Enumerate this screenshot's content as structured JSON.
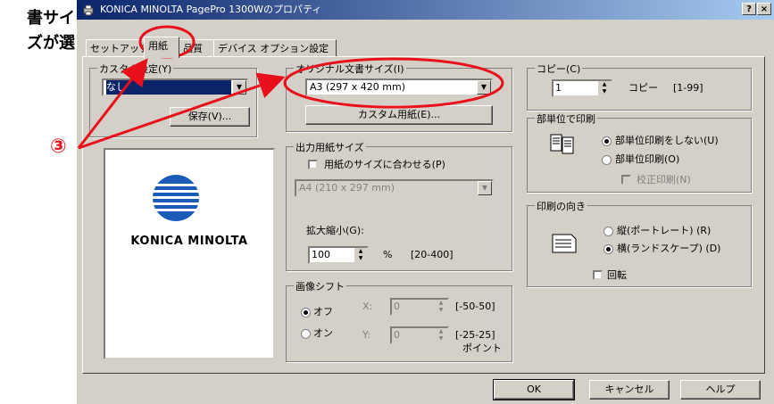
{
  "doc": {
    "line1": "書サイ",
    "line2": "ズが選"
  },
  "window": {
    "title": "KONICA MINOLTA PagePro 1300Wのプロパティ",
    "help_btn": "?",
    "close_btn": "×"
  },
  "tabs": [
    {
      "label": "セットアップ"
    },
    {
      "label": "用紙"
    },
    {
      "label": "品質"
    },
    {
      "label": "デバイス オプション設定"
    }
  ],
  "custom": {
    "label": "カスタム設定(Y)",
    "value": "なし",
    "save": "保存(V)..."
  },
  "logo": {
    "text": "KONICA MINOLTA"
  },
  "paper": {
    "label": "オリジナル文書サイズ(I)",
    "value": "A3 (297 x 420 mm)",
    "custom_button": "カスタム用紙(E)..."
  },
  "output": {
    "label": "出力用紙サイズ",
    "fit": "用紙のサイズに合わせる(P)",
    "size": "A4 (210 x 297 mm)",
    "zoom_label": "拡大縮小(G):",
    "zoom_value": "100",
    "zoom_unit": "%",
    "zoom_range": "[20-400]"
  },
  "shift": {
    "label": "画像シフト",
    "off": "オフ",
    "on": "オン",
    "x_label": "X:",
    "x_value": "0",
    "x_range": "[-50-50]",
    "y_label": "Y:",
    "y_value": "0",
    "y_range": "[-25-25]",
    "unit": "ポイント"
  },
  "copies": {
    "label": "コピー(C)",
    "value": "1",
    "unit": "コピー",
    "range": "[1-99]"
  },
  "collate": {
    "label": "部単位で印刷",
    "no": "部単位印刷をしない(U)",
    "yes": "部単位印刷(O)",
    "proof": "校正印刷(N)"
  },
  "orientation": {
    "label": "印刷の向き",
    "portrait": "縦(ポートレート) (R)",
    "landscape": "横(ランドスケープ) (D)",
    "rotate": "回転"
  },
  "footer": {
    "ok": "OK",
    "cancel": "キャンセル",
    "help": "ヘルプ"
  },
  "annotation": {
    "number": "③"
  },
  "colors": {
    "annotation_red": "#e8101a",
    "title_blue": "#0a246a",
    "logo_blue": "#1a5bb8"
  }
}
